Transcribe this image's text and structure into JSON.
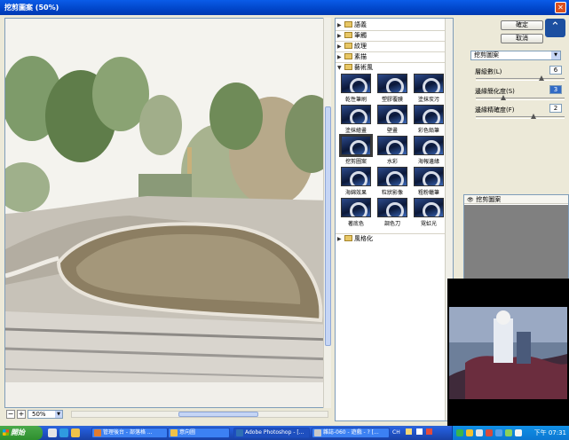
{
  "window": {
    "title": "挖剪圖案 (50%)",
    "close_glyph": "✕"
  },
  "preview": {
    "zoom": "50%",
    "zoom_out": "−",
    "zoom_in": "+"
  },
  "gallery": {
    "categories_top": [
      "語義",
      "筆觸",
      "紋理",
      "素描"
    ],
    "open_category": "藝術風",
    "filters": [
      "乾性筆刷",
      "塑膠覆膜",
      "塗抹炭污",
      "塗抹繪畫",
      "壁畫",
      "彩色鉛筆",
      "挖剪圖案",
      "水彩",
      "海報邊緣",
      "海綿效果",
      "粒狀影像",
      "粗粉蠟筆",
      "著底色",
      "調色刀",
      "霓虹光"
    ],
    "selected_filter": "挖剪圖案",
    "category_bottom": "風格化"
  },
  "panel": {
    "ok_label": "確定",
    "cancel_label": "取消",
    "filter_select": "挖剪圖案",
    "params": [
      {
        "label": "層級數(L)",
        "value": "6",
        "level": 0.75
      },
      {
        "label": "邊緣簡化度(S)",
        "value": "3",
        "level": 0.3
      },
      {
        "label": "邊緣精確度(F)",
        "value": "2",
        "level": 0.66
      }
    ],
    "layer_name": "挖剪圖案"
  },
  "taskbar": {
    "start_label": "開始",
    "tasks": [
      {
        "label": "管理後台 - 部落格 ...",
        "active": false
      },
      {
        "label": "意向圖",
        "active": false
      },
      {
        "label": "Adobe Photoshop - [...",
        "active": true
      },
      {
        "label": "雜誌-060 - 遊戲 - ? [...",
        "active": false
      }
    ],
    "lang": "CH",
    "clock": "下午 07:31"
  },
  "colors": {
    "title_blue": "#0145c9",
    "taskbar_blue": "#245ddb",
    "start_green": "#3c9a3c"
  }
}
